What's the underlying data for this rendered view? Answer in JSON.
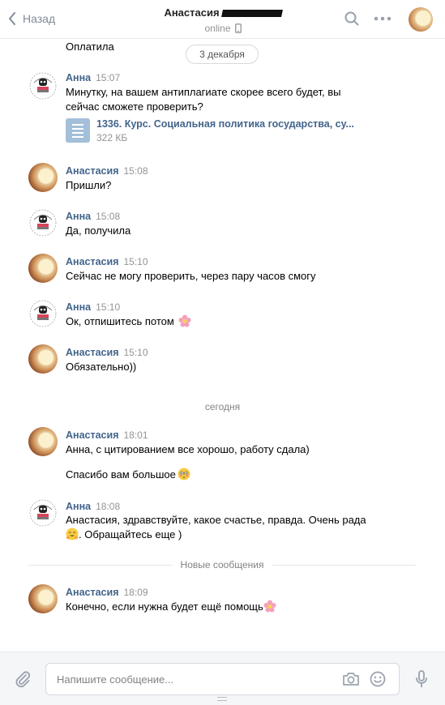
{
  "header": {
    "back_label": "Назад",
    "contact_name": "Анастасия",
    "status": "online"
  },
  "dates": {
    "first": "3 декабря",
    "today": "сегодня"
  },
  "divider": {
    "new_messages": "Новые сообщения"
  },
  "messages": [
    {
      "text": "Оплатила"
    },
    {
      "author": "Анна",
      "time": "15:07",
      "text": "Минутку, на вашем антиплагиате скорее всего будет, вы сейчас сможете проверить?"
    },
    {
      "author": "Анастасия",
      "time": "15:08",
      "text": "Пришли?"
    },
    {
      "author": "Анна",
      "time": "15:08",
      "text": "Да, получила"
    },
    {
      "author": "Анастасия",
      "time": "15:10",
      "text": "Сейчас не могу проверить, через пару часов смогу"
    },
    {
      "author": "Анна",
      "time": "15:10",
      "text": "Ок, отпишитесь потом"
    },
    {
      "author": "Анастасия",
      "time": "15:10",
      "text": "Обязательно))"
    },
    {
      "author": "Анастасия",
      "time": "18:01",
      "text": "Анна, с цитированием все хорошо, работу сдала)"
    },
    {
      "text": "Спасибо вам большое"
    },
    {
      "author": "Анна",
      "time": "18:08",
      "text_line1": "Анастасия, здравствуйте, какое счастье, правда. Очень рада",
      "text_line2": ". Обращайтесь еще )"
    },
    {
      "author": "Анастасия",
      "time": "18:09",
      "text": "Конечно, если нужна будет ещё помощь"
    }
  ],
  "attachment": {
    "name": "1336. Курс. Социальная политика государства, су...",
    "size": "322 КБ",
    "icon": "document-icon"
  },
  "composer": {
    "placeholder": "Напишите сообщение..."
  },
  "colors": {
    "link_name": "#42648b",
    "muted": "#939393",
    "file_icon": "#a3bfd9"
  }
}
